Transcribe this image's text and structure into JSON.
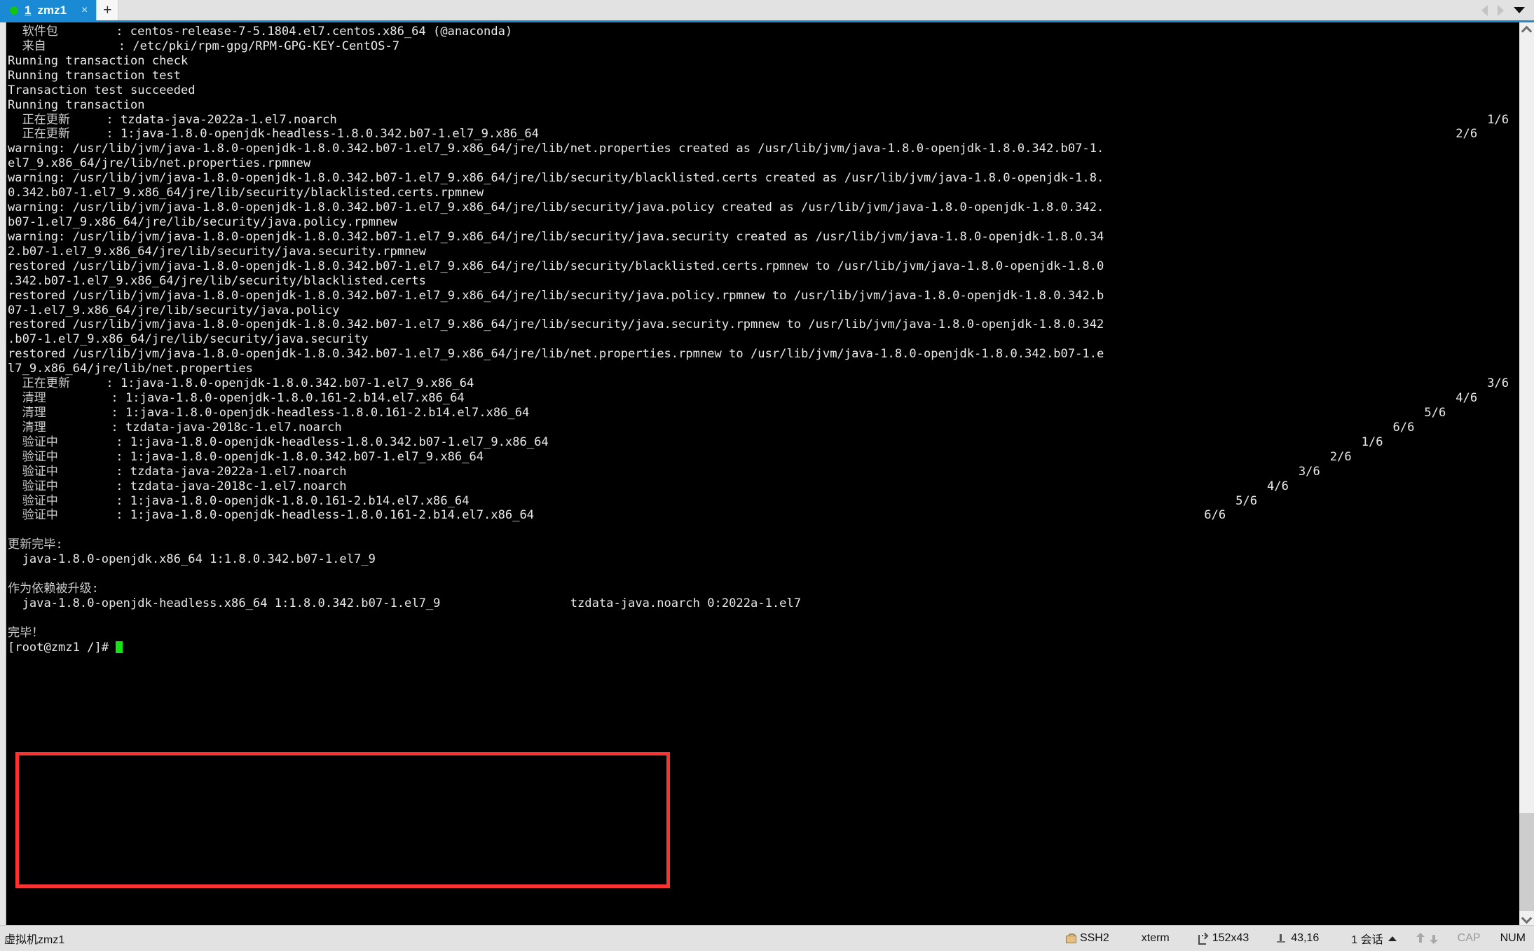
{
  "window": {
    "tabbar": {
      "tab": {
        "number": "1",
        "title": "zmz1",
        "close_label": "×",
        "status_dot_color": "#14c413"
      },
      "new_tab_label": "+",
      "nav_prev_icon": "triangle-left-icon",
      "nav_next_icon": "triangle-right-icon",
      "tab_list_icon": "chevron-down-icon"
    },
    "accent_color": "#1a8ad4",
    "highlight_box_color": "#f93232"
  },
  "terminal": {
    "foreground": "#e9e9e9",
    "background": "#000000",
    "cursor_color": "#14e614",
    "columns": 152,
    "rows": 43,
    "lines": [
      {
        "cjk": "  软件包",
        "text": "        : centos-release-7-5.1804.el7.centos.x86_64 (@anaconda)"
      },
      {
        "cjk": "  来自",
        "text": "          : /etc/pki/rpm-gpg/RPM-GPG-KEY-CentOS-7"
      },
      {
        "text": "Running transaction check"
      },
      {
        "text": "Running transaction test"
      },
      {
        "text": "Transaction test succeeded"
      },
      {
        "text": "Running transaction"
      },
      {
        "cjk": "  正在更新",
        "text": "     : tzdata-java-2022a-1.el7.noarch",
        "counter": "1/6"
      },
      {
        "cjk": "  正在更新",
        "text": "     : 1:java-1.8.0-openjdk-headless-1.8.0.342.b07-1.el7_9.x86_64",
        "counter": "2/6"
      },
      {
        "text": "warning: /usr/lib/jvm/java-1.8.0-openjdk-1.8.0.342.b07-1.el7_9.x86_64/jre/lib/net.properties created as /usr/lib/jvm/java-1.8.0-openjdk-1.8.0.342.b07-1."
      },
      {
        "text": "el7_9.x86_64/jre/lib/net.properties.rpmnew"
      },
      {
        "text": "warning: /usr/lib/jvm/java-1.8.0-openjdk-1.8.0.342.b07-1.el7_9.x86_64/jre/lib/security/blacklisted.certs created as /usr/lib/jvm/java-1.8.0-openjdk-1.8."
      },
      {
        "text": "0.342.b07-1.el7_9.x86_64/jre/lib/security/blacklisted.certs.rpmnew"
      },
      {
        "text": "warning: /usr/lib/jvm/java-1.8.0-openjdk-1.8.0.342.b07-1.el7_9.x86_64/jre/lib/security/java.policy created as /usr/lib/jvm/java-1.8.0-openjdk-1.8.0.342."
      },
      {
        "text": "b07-1.el7_9.x86_64/jre/lib/security/java.policy.rpmnew"
      },
      {
        "text": "warning: /usr/lib/jvm/java-1.8.0-openjdk-1.8.0.342.b07-1.el7_9.x86_64/jre/lib/security/java.security created as /usr/lib/jvm/java-1.8.0-openjdk-1.8.0.34"
      },
      {
        "text": "2.b07-1.el7_9.x86_64/jre/lib/security/java.security.rpmnew"
      },
      {
        "text": "restored /usr/lib/jvm/java-1.8.0-openjdk-1.8.0.342.b07-1.el7_9.x86_64/jre/lib/security/blacklisted.certs.rpmnew to /usr/lib/jvm/java-1.8.0-openjdk-1.8.0"
      },
      {
        "text": ".342.b07-1.el7_9.x86_64/jre/lib/security/blacklisted.certs"
      },
      {
        "text": "restored /usr/lib/jvm/java-1.8.0-openjdk-1.8.0.342.b07-1.el7_9.x86_64/jre/lib/security/java.policy.rpmnew to /usr/lib/jvm/java-1.8.0-openjdk-1.8.0.342.b"
      },
      {
        "text": "07-1.el7_9.x86_64/jre/lib/security/java.policy"
      },
      {
        "text": "restored /usr/lib/jvm/java-1.8.0-openjdk-1.8.0.342.b07-1.el7_9.x86_64/jre/lib/security/java.security.rpmnew to /usr/lib/jvm/java-1.8.0-openjdk-1.8.0.342"
      },
      {
        "text": ".b07-1.el7_9.x86_64/jre/lib/security/java.security"
      },
      {
        "text": "restored /usr/lib/jvm/java-1.8.0-openjdk-1.8.0.342.b07-1.el7_9.x86_64/jre/lib/net.properties.rpmnew to /usr/lib/jvm/java-1.8.0-openjdk-1.8.0.342.b07-1.e"
      },
      {
        "text": "l7_9.x86_64/jre/lib/net.properties"
      },
      {
        "cjk": "  正在更新",
        "text": "     : 1:java-1.8.0-openjdk-1.8.0.342.b07-1.el7_9.x86_64",
        "counter": "3/6"
      },
      {
        "cjk": "  清理",
        "text": "         : 1:java-1.8.0-openjdk-1.8.0.161-2.b14.el7.x86_64",
        "counter": "4/6"
      },
      {
        "cjk": "  清理",
        "text": "         : 1:java-1.8.0-openjdk-headless-1.8.0.161-2.b14.el7.x86_64",
        "counter": "5/6"
      },
      {
        "cjk": "  清理",
        "text": "         : tzdata-java-2018c-1.el7.noarch",
        "counter": "6/6"
      },
      {
        "cjk": "  验证中",
        "text": "        : 1:java-1.8.0-openjdk-headless-1.8.0.342.b07-1.el7_9.x86_64",
        "counter": "1/6"
      },
      {
        "cjk": "  验证中",
        "text": "        : 1:java-1.8.0-openjdk-1.8.0.342.b07-1.el7_9.x86_64",
        "counter": "2/6"
      },
      {
        "cjk": "  验证中",
        "text": "        : tzdata-java-2022a-1.el7.noarch",
        "counter": "3/6"
      },
      {
        "cjk": "  验证中",
        "text": "        : tzdata-java-2018c-1.el7.noarch",
        "counter": "4/6"
      },
      {
        "cjk": "  验证中",
        "text": "        : 1:java-1.8.0-openjdk-1.8.0.161-2.b14.el7.x86_64",
        "counter": "5/6"
      },
      {
        "cjk": "  验证中",
        "text": "        : 1:java-1.8.0-openjdk-headless-1.8.0.161-2.b14.el7.x86_64",
        "counter": "6/6"
      },
      {
        "text": ""
      },
      {
        "cjk": "更新完毕:",
        "text": ""
      },
      {
        "text": "  java-1.8.0-openjdk.x86_64 1:1.8.0.342.b07-1.el7_9"
      },
      {
        "text": ""
      },
      {
        "cjk": "作为依赖被升级:",
        "text": ""
      },
      {
        "text": "  java-1.8.0-openjdk-headless.x86_64 1:1.8.0.342.b07-1.el7_9                  tzdata-java.noarch 0:2022a-1.el7"
      },
      {
        "text": ""
      },
      {
        "cjk": "完毕！",
        "text": ""
      },
      {
        "text": "[root@zmz1 /]# ",
        "cursor": true
      }
    ]
  },
  "statusbar": {
    "session_name": "虚拟机zmz1",
    "protocol": "SSH2",
    "protocol_icon": "lock-icon",
    "emulation": "xterm",
    "size": "152x43",
    "size_icon": "resize-icon",
    "cursor_pos": "43,16",
    "cursor_icon": "cursor-position-icon",
    "sessions": "1 会话",
    "sessions_caret_icon": "caret-up-icon",
    "transmit_icon": "arrow-up-icon",
    "receive_icon": "arrow-down-icon",
    "caps_lock": "CAP",
    "num_lock": "NUM"
  }
}
